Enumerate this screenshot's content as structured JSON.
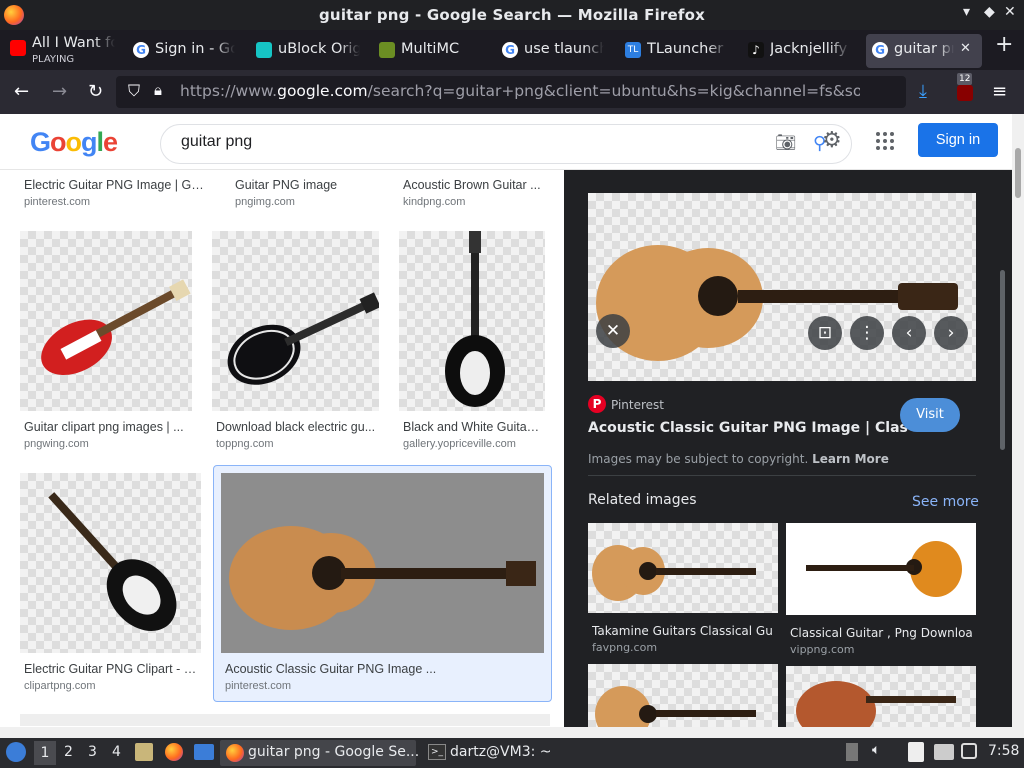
{
  "window": {
    "title": "guitar png - Google Search — Mozilla Firefox"
  },
  "tabs": [
    {
      "label": "All I Want fo",
      "sub": "PLAYING",
      "icon": "youtube-icon",
      "color": "#ff0000"
    },
    {
      "label": "Sign in - Go",
      "icon": "google-icon",
      "color": "#4285f4"
    },
    {
      "label": "uBlock Origi",
      "icon": "ublock-icon",
      "color": "#16c5c5"
    },
    {
      "label": "MultiMC",
      "icon": "multimc-icon",
      "color": "#6b8e23"
    },
    {
      "label": "use tlaunch",
      "icon": "google-icon",
      "color": "#4285f4"
    },
    {
      "label": "TLauncher -",
      "icon": "tlauncher-icon",
      "color": "#2d7ee0"
    },
    {
      "label": "Jacknjellify",
      "icon": "tiktok-icon",
      "color": "#111111"
    },
    {
      "label": "guitar png",
      "icon": "google-icon",
      "color": "#4285f4"
    }
  ],
  "nav": {
    "url_prefix": "https://www.",
    "url_domain": "google.com",
    "url_rest": "/search?q=guitar+png&client=ubuntu&hs=kig&channel=fs&source=lnms",
    "badge": "12"
  },
  "google": {
    "logo": "Google",
    "query": "guitar png",
    "signin": "Sign in"
  },
  "results": [
    {
      "title": "Electric Guitar PNG Image | Gui...",
      "source": "pinterest.com"
    },
    {
      "title": "Guitar PNG image",
      "source": "pngimg.com"
    },
    {
      "title": "Acoustic Brown Guitar ...",
      "source": "kindpng.com"
    },
    {
      "title": "Guitar clipart png images | ...",
      "source": "pngwing.com"
    },
    {
      "title": "Download black electric gu...",
      "source": "toppng.com"
    },
    {
      "title": "Black and White Guitar ...",
      "source": "gallery.yopriceville.com"
    },
    {
      "title": "Electric Guitar PNG Clipart - B...",
      "source": "clipartpng.com"
    },
    {
      "title": "Acoustic Classic Guitar PNG Image ...",
      "source": "pinterest.com"
    }
  ],
  "panel": {
    "source": "Pinterest",
    "title": "Acoustic Classic Guitar PNG Image | Classi...",
    "visit": "Visit",
    "copyright": "Images may be subject to copyright.",
    "learn_more": "Learn More",
    "related": "Related images",
    "see_more": "See more",
    "related_items": [
      {
        "title": "Takamine Guitars Classical Gui...",
        "source": "favpng.com"
      },
      {
        "title": "Classical Guitar , Png Downloa...",
        "source": "vippng.com"
      }
    ]
  },
  "taskbar": {
    "workspaces": [
      "1",
      "2",
      "3",
      "4"
    ],
    "task1": "guitar png - Google Se...",
    "task2": "dartz@VM3: ~",
    "clock": "7:58"
  }
}
